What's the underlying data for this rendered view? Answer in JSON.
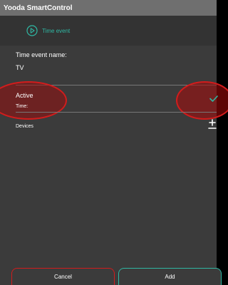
{
  "app": {
    "title": "Yooda SmartControl"
  },
  "header": {
    "label": "Time event",
    "icon": "play-circle-icon",
    "accent": "#2fb8a4"
  },
  "form": {
    "name_label": "Time event name:",
    "name_value": "TV",
    "active_label": "Active",
    "time_label": "Time:",
    "active_checked": true,
    "devices_label": "Devices"
  },
  "buttons": {
    "cancel": "Cancel",
    "add": "Add"
  },
  "colors": {
    "highlight": "#d21c1c",
    "accent": "#2fb8a4",
    "titlebar": "#6f6f6f",
    "panel": "#3b3b3b"
  }
}
